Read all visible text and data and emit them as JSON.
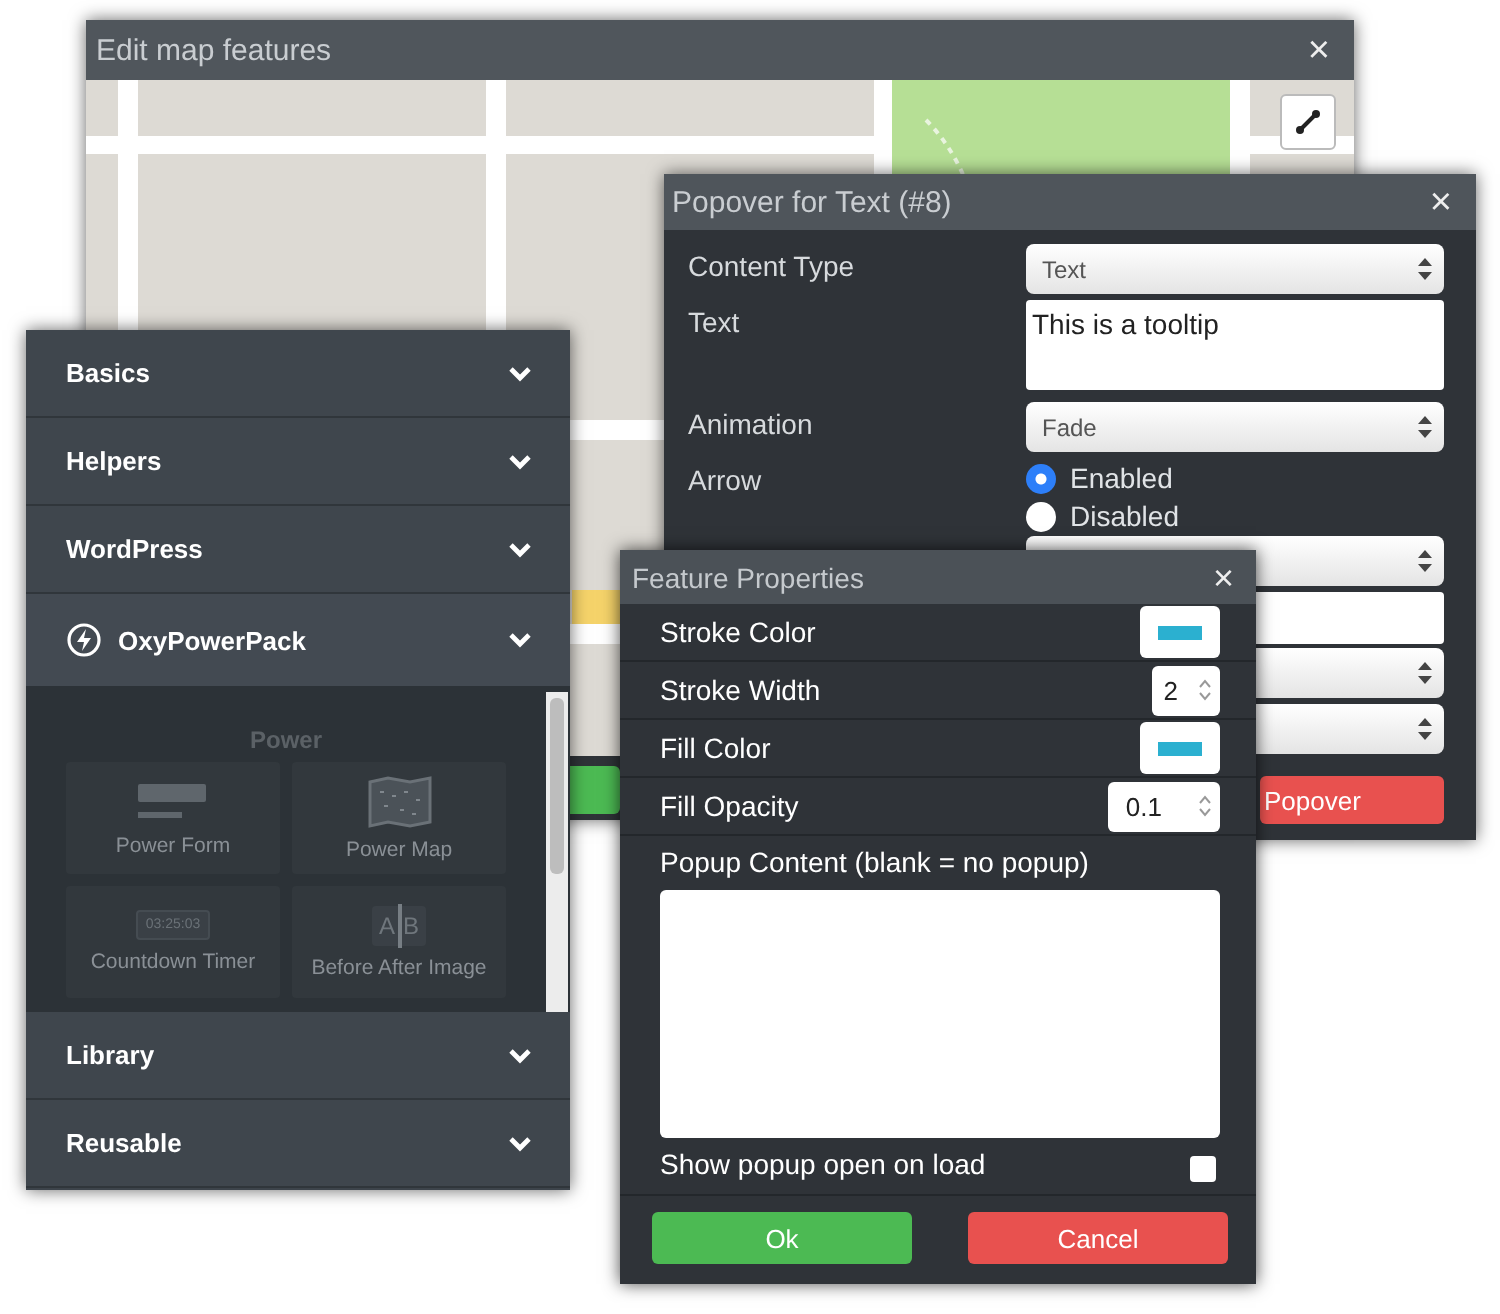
{
  "map_window": {
    "title": "Edit map features",
    "close": "×"
  },
  "popover_window": {
    "title": "Popover for Text (#8)",
    "close": "×",
    "fields": [
      {
        "kind": "select",
        "label": "Content Type",
        "value": "Text"
      },
      {
        "kind": "textarea",
        "label": "Text",
        "value": "This is a tooltip"
      },
      {
        "kind": "select",
        "label": "Animation",
        "value": "Fade"
      },
      {
        "kind": "radio",
        "label": "Arrow",
        "options": [
          {
            "label": "Enabled",
            "selected": true
          },
          {
            "label": "Disabled",
            "selected": false
          }
        ]
      },
      {
        "kind": "select"
      },
      {
        "kind": "input"
      },
      {
        "kind": "select"
      },
      {
        "kind": "select"
      }
    ],
    "button": "Popover"
  },
  "sidebar": {
    "sections": [
      {
        "label": "Basics",
        "expanded": false
      },
      {
        "label": "Helpers",
        "expanded": false
      },
      {
        "label": "WordPress",
        "expanded": false
      },
      {
        "label": "OxyPowerPack",
        "kind": "plugin",
        "expanded": true,
        "group": "Power",
        "tiles": [
          {
            "kind": "form",
            "label": "Power Form"
          },
          {
            "kind": "map",
            "label": "Power Map"
          },
          {
            "kind": "timer",
            "label": "Countdown Timer",
            "display": "03:25:03"
          },
          {
            "kind": "compare",
            "label": "Before After Image",
            "display": [
              "A",
              "B"
            ]
          }
        ]
      },
      {
        "label": "Library",
        "expanded": false
      },
      {
        "label": "Reusable",
        "expanded": false
      }
    ]
  },
  "feature_window": {
    "title": "Feature Properties",
    "close": "×",
    "rows": [
      {
        "kind": "color",
        "label": "Stroke Color",
        "color": "#2bb0d0"
      },
      {
        "kind": "number",
        "label": "Stroke Width",
        "value": "2"
      },
      {
        "kind": "color",
        "label": "Fill Color",
        "color": "#2bb0d0"
      },
      {
        "kind": "number",
        "label": "Fill Opacity",
        "value": "0.1"
      }
    ],
    "popup_label": "Popup Content (blank = no popup)",
    "checkbox": {
      "label": "Show popup open on load",
      "checked": false
    },
    "buttons": [
      {
        "kind": "ok",
        "label": "Ok"
      },
      {
        "kind": "cancel",
        "label": "Cancel"
      }
    ]
  }
}
